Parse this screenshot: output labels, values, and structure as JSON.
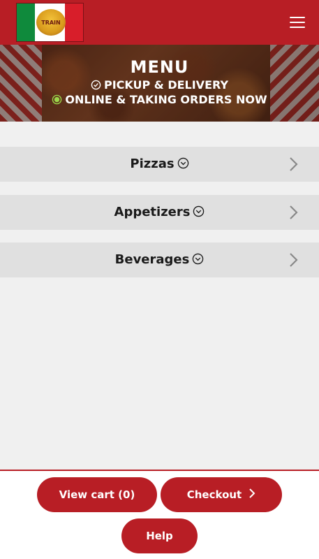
{
  "header": {
    "logo_alt": "Train Pizza",
    "menu_icon": "hamburger-menu-icon"
  },
  "hero": {
    "title": "MENU",
    "line1": "PICKUP & DELIVERY",
    "line2": "ONLINE & TAKING ORDERS NOW",
    "status_color": "#9bd54a"
  },
  "categories": [
    {
      "label": "Pizzas"
    },
    {
      "label": "Appetizers"
    },
    {
      "label": "Beverages"
    }
  ],
  "footer": {
    "view_cart_label": "View cart (0)",
    "checkout_label": "Checkout",
    "help_label": "Help"
  },
  "colors": {
    "brand_red": "#b81e25",
    "category_bg": "#e0e0e0",
    "page_bg": "#f0f0f0"
  }
}
